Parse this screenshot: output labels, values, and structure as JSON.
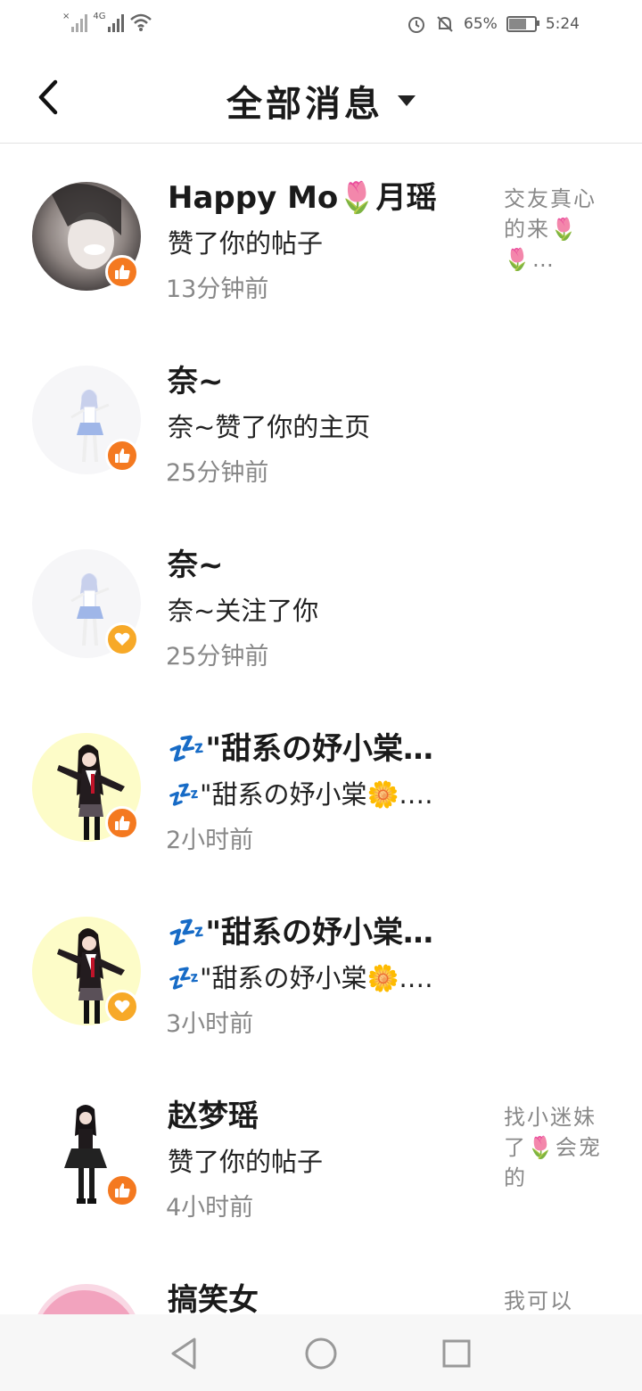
{
  "status_bar": {
    "network": "4G",
    "battery": "65%",
    "battery_level": 0.65,
    "time": "5:24"
  },
  "header": {
    "title": "全部消息"
  },
  "messages": [
    {
      "name": "Happy Mo🌷月瑶",
      "action": "赞了你的帖子",
      "time": "13分钟前",
      "preview": "交友真心的来🌷🌷…",
      "badge": "thumbs-up-icon",
      "avatar": "photo"
    },
    {
      "name": "奈~",
      "action": "奈~赞了你的主页",
      "time": "25分钟前",
      "preview": "",
      "badge": "thumbs-up-icon",
      "avatar": "anime-girl-white"
    },
    {
      "name": "奈~",
      "action": "奈~关注了你",
      "time": "25分钟前",
      "preview": "",
      "badge": "heart-icon",
      "avatar": "anime-girl-white"
    },
    {
      "name": "💤\"甜系の妤小棠…",
      "action": "💤\"甜系の妤小棠🌼.…",
      "time": "2小时前",
      "preview": "",
      "badge": "thumbs-up-icon",
      "avatar": "anime-girl-yellow"
    },
    {
      "name": "💤\"甜系の妤小棠…",
      "action": "💤\"甜系の妤小棠🌼.…",
      "time": "3小时前",
      "preview": "",
      "badge": "heart-icon",
      "avatar": "anime-girl-yellow"
    },
    {
      "name": "赵梦瑶",
      "action": "赞了你的帖子",
      "time": "4小时前",
      "preview": "找小迷妹了🌷会宠的",
      "badge": "thumbs-up-icon",
      "avatar": "gothic-girl"
    },
    {
      "name": "搞笑女",
      "action": "",
      "time": "",
      "preview": "我可以",
      "badge": "",
      "avatar": "pink-hair"
    }
  ],
  "colors": {
    "like_badge": "#f47920",
    "follow_badge": "#f7a928"
  },
  "nav": {
    "back": "back-triangle",
    "home": "home-circle",
    "recents": "recents-square"
  }
}
